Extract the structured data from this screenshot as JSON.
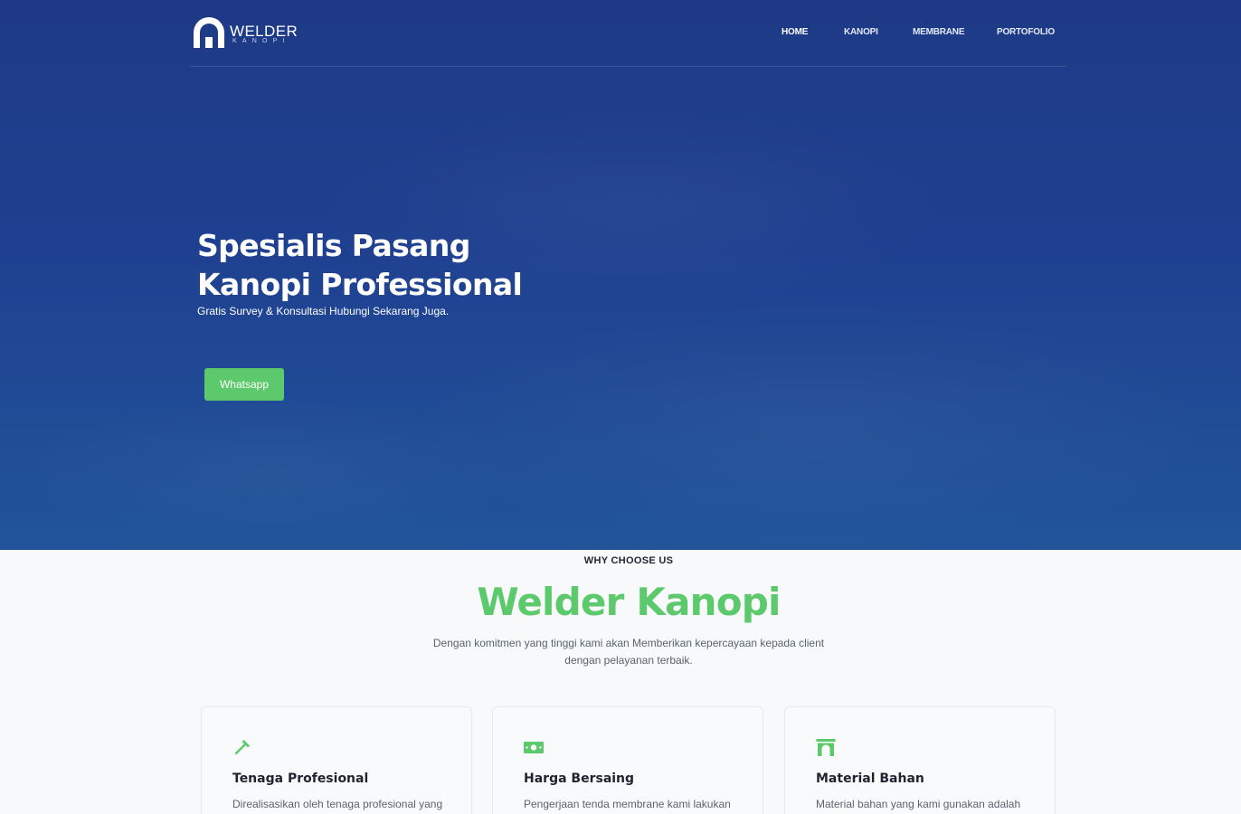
{
  "brand": {
    "name": "WELDER",
    "tagline": "KANOPI"
  },
  "nav": {
    "items": [
      {
        "label": "HOME",
        "active": true
      },
      {
        "label": "KANOPI",
        "active": false
      },
      {
        "label": "MEMBRANE",
        "active": false
      },
      {
        "label": "PORTOFOLIO",
        "active": false
      }
    ]
  },
  "hero": {
    "title_line1": "Spesialis Pasang",
    "title_line2": "Kanopi Professional",
    "subtitle": "Gratis Survey & Konsultasi Hubungi Sekarang Juga.",
    "cta_label": "Whatsapp"
  },
  "why": {
    "eyebrow": "WHY CHOOSE US",
    "title": "Welder Kanopi",
    "description": "Dengan komitmen yang tinggi kami akan Memberikan kepercayaan kepada client dengan pelayanan terbaik."
  },
  "features": [
    {
      "icon": "hammer-icon",
      "title": "Tenaga Profesional",
      "text": "Direalisasikan oleh tenaga profesional yang"
    },
    {
      "icon": "money-icon",
      "title": "Harga Bersaing",
      "text": "Pengerjaan tenda membrane kami lakukan"
    },
    {
      "icon": "arch-icon",
      "title": "Material Bahan",
      "text": "Material bahan yang kami gunakan adalah"
    }
  ],
  "colors": {
    "hero_bg_top": "#1e3a86",
    "hero_bg_bottom": "#21559a",
    "accent_green": "#5cc96c",
    "text_dark": "#1f2430",
    "text_muted": "#5a6272",
    "page_bg": "#f8f9fa"
  }
}
